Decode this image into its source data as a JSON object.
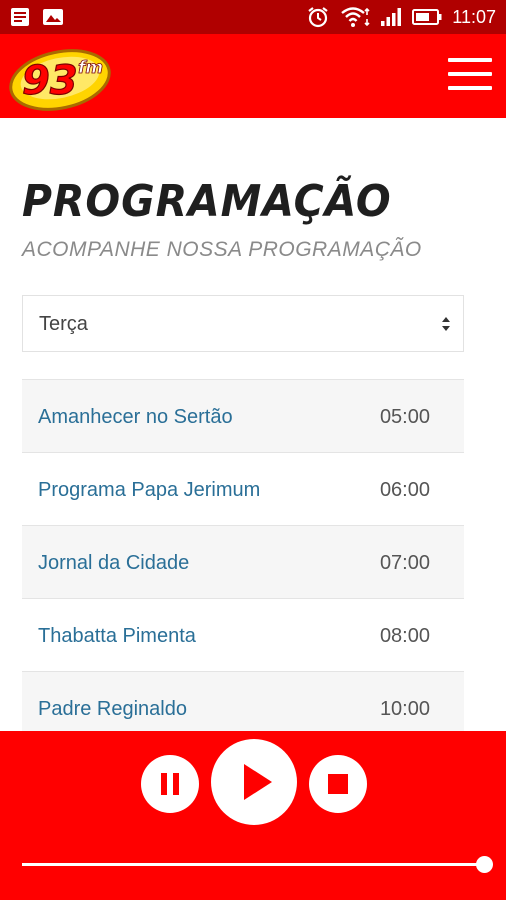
{
  "status_bar": {
    "time": "11:07",
    "icons": [
      "notification-icon",
      "image-icon",
      "alarm-icon",
      "wifi-icon",
      "signal-icon",
      "battery-icon"
    ]
  },
  "header": {
    "logo_text": "93",
    "logo_suffix": "fm",
    "menu_icon": "hamburger-menu-icon",
    "background_color": "#ff0000"
  },
  "page": {
    "title": "PROGRAMAÇÃO",
    "subtitle": "ACOMPANHE NOSSA PROGRAMAÇÃO"
  },
  "day_select": {
    "selected": "Terça"
  },
  "schedule": [
    {
      "name": "Amanhecer no Sertão",
      "time": "05:00"
    },
    {
      "name": "Programa Papa Jerimum",
      "time": "06:00"
    },
    {
      "name": "Jornal da Cidade",
      "time": "07:00"
    },
    {
      "name": "Thabatta Pimenta",
      "time": "08:00"
    },
    {
      "name": "Padre Reginaldo",
      "time": "10:00"
    }
  ],
  "player": {
    "controls": [
      "pause-icon",
      "play-icon",
      "stop-icon"
    ],
    "volume": 1.0,
    "background_color": "#ff0000"
  }
}
